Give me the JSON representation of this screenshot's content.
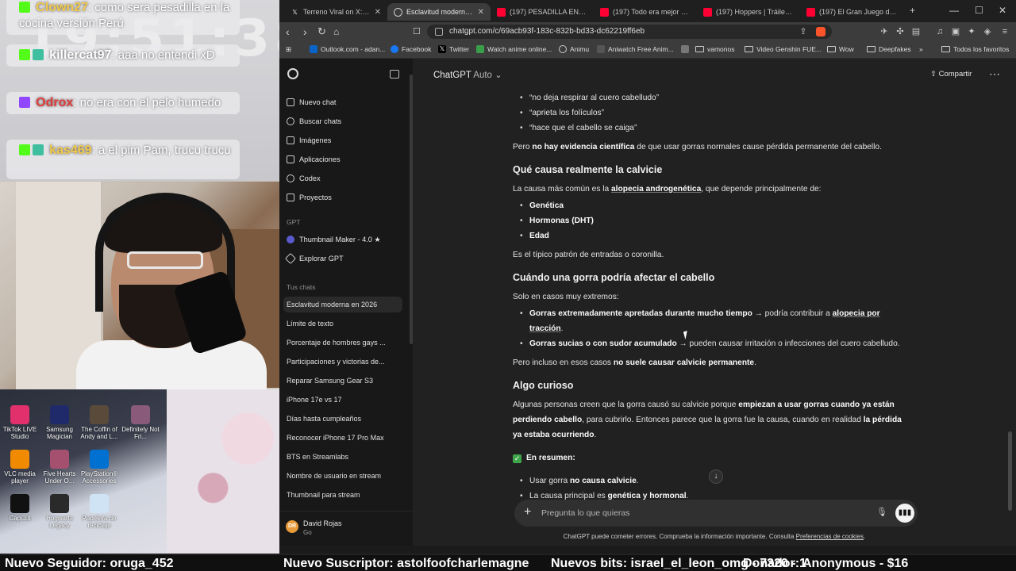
{
  "overlay": {
    "clock_ghost": "19:51:38",
    "chat": [
      {
        "user": "Clown27",
        "text": ": como sera pesadilla en la cocina versión Perú",
        "color": "#f2c94c"
      },
      {
        "user": "killercat97",
        "text": ": aaa no entendi xD",
        "color": "#ffffff"
      },
      {
        "user": "Odrox",
        "text": ": no era con el pelo humedo",
        "color": "#e23b3b"
      },
      {
        "user": "kas469",
        "text": ": a el pim Pam, trucu trucu",
        "color": "#f2c94c"
      }
    ],
    "desktop_icons": [
      "TikTok LIVE Studio",
      "Samsung Magician",
      "The Coffin of Andy and L...",
      "Definitely Not Fri...",
      "VLC media player",
      "Five Hearts Under O...",
      "PlayStation® Accessories",
      "CapCut",
      "Hogwarts Legacy",
      "Papelera de reciclaje"
    ],
    "taskbar_small": [
      "NIKKE",
      "StreamerBot",
      "Photopea",
      "GRYPHLINK"
    ]
  },
  "browser": {
    "tabs": [
      {
        "label": "Terreno Viral on X: \"Plex de",
        "icon": "x-icon"
      },
      {
        "label": "Esclavitud moderna en",
        "icon": "chatgpt-icon",
        "active": true
      },
      {
        "label": "(197) PESADILLA EN LA CO",
        "icon": "youtube-icon"
      },
      {
        "label": "(197) Todo era mejor antes",
        "icon": "youtube-icon"
      },
      {
        "label": "(197) Hoppers | Tráiler oficia",
        "icon": "youtube-icon"
      },
      {
        "label": "(197) El Gran Juego de la O",
        "icon": "youtube-icon"
      }
    ],
    "new_tab": "+",
    "url": "chatgpt.com/c/69acb93f-183c-832b-bd33-dc62219ff6eb",
    "bookmarks": [
      "Outlook.com - adan...",
      "Facebook",
      "Twitter",
      "Watch anime online...",
      "Animu",
      "Aniwatch Free Anim...",
      "vamonos",
      "Video Genshin FUE...",
      "Wow",
      "Deepfakes",
      "Todos los favoritos"
    ]
  },
  "sidebar": {
    "items": [
      "Nuevo chat",
      "Buscar chats",
      "Imágenes",
      "Aplicaciones",
      "Codex",
      "Proyectos"
    ],
    "gpt_section": "GPT",
    "gpts": [
      "Thumbnail Maker - 4.0 ★",
      "Explorar GPT"
    ],
    "chats_section": "Tus chats",
    "chats": [
      "Esclavitud moderna en 2026",
      "Límite de texto",
      "Porcentaje de hombres gays ...",
      "Participaciones y victorias de...",
      "Reparar Samsung Gear S3",
      "iPhone 17e vs 17",
      "Días hasta cumpleaños",
      "Reconocer iPhone 17 Pro Max",
      "BTS en Streamlabs",
      "Nombre de usuario en stream",
      "Thumbnail para stream"
    ],
    "user": {
      "initials": "DR",
      "name": "David Rojas",
      "plan": "Go"
    }
  },
  "topbar": {
    "model": "ChatGPT",
    "mode": "Auto",
    "share": "Compartir"
  },
  "content": {
    "bullets1": [
      "“no deja respirar al cuero cabelludo”",
      "“aprieta los folículos”",
      "“hace que el cabello se caiga”"
    ],
    "p1_pre": "Pero ",
    "p1_bold": "no hay evidencia científica",
    "p1_post": " de que usar gorras normales cause pérdida permanente del cabello.",
    "h1": "Qué causa realmente la calvicie",
    "p2_pre": "La causa más común es la ",
    "p2_bold": "alopecia androgenética",
    "p2_post": ", que depende principalmente de:",
    "bullets2": [
      "Genética",
      "Hormonas (DHT)",
      "Edad"
    ],
    "p3": "Es el típico patrón de entradas o coronilla.",
    "h2": "Cuándo una gorra podría afectar el cabello",
    "p4": "Solo en casos muy extremos:",
    "b3a_bold": "Gorras extremadamente apretadas durante mucho tiempo",
    "b3a_mid": " → podría contribuir a ",
    "b3a_link": "alopecia por tracción",
    "b3a_end": ".",
    "b3b_bold": "Gorras sucias o con sudor acumulado",
    "b3b_rest": " → pueden causar irritación o infecciones del cuero cabelludo.",
    "p5_pre": "Pero incluso en esos casos ",
    "p5_bold": "no suele causar calvicie permanente",
    "p5_post": ".",
    "h3": "Algo curioso",
    "p6_a": "Algunas personas creen que la gorra causó su calvicie porque ",
    "p6_b": "empiezan a usar gorras cuando ya están perdiendo cabello",
    "p6_c": ", para cubrirlo. Entonces parece que la gorra fue la causa, cuando en realidad ",
    "p6_d": "la pérdida ya estaba ocurriendo",
    "p6_e": ".",
    "summary": "En resumen:",
    "s1_pre": "Usar gorra ",
    "s1_bold": "no causa calvicie",
    "s1_post": ".",
    "s2_pre": "La causa principal es ",
    "s2_bold": "genética y hormonal",
    "s2_post": "."
  },
  "composer": {
    "placeholder": "Pregunta lo que quieras"
  },
  "disclaimer": {
    "text": "ChatGPT puede cometer errores. Comprueba la información importante. Consulta ",
    "link": "Preferencias de cookies",
    "end": "."
  },
  "ticker": [
    "Nuevo Seguidor: oruga_452",
    "Nuevo Suscriptor: astolfoofcharlemagne",
    "Nuevos bits: israel_el_leon_omg - 7320 - 1",
    "Donador: Anonymous - $16"
  ]
}
